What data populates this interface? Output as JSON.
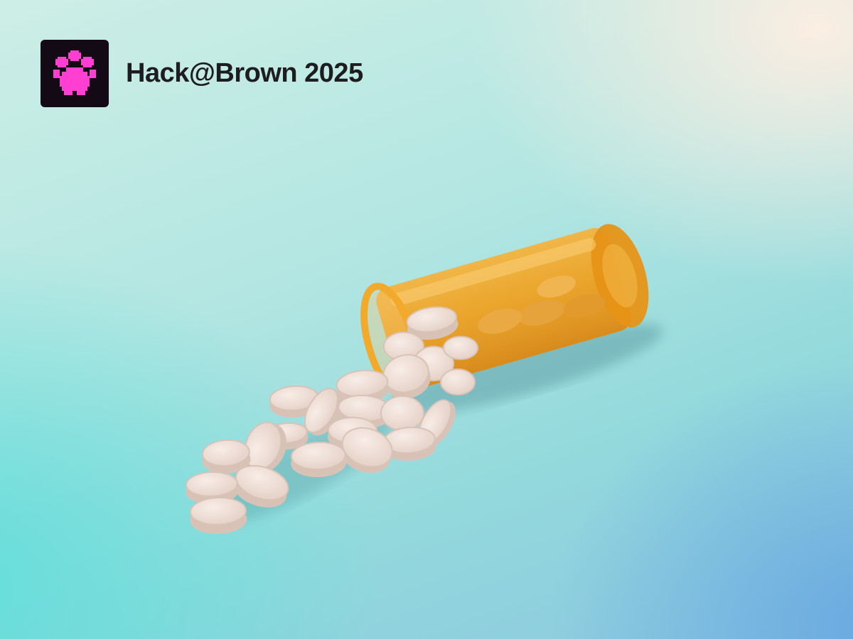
{
  "brand": {
    "name": "Hack@Brown 2025",
    "logo_icon": "pixel-paw-icon",
    "logo_bg": "#140a16",
    "logo_color": "#ff3fd2"
  },
  "photo": {
    "subject_icon": "pill-bottle-icon",
    "bottle_color": "#f0a21c",
    "pill_color": "#f1e2da"
  }
}
